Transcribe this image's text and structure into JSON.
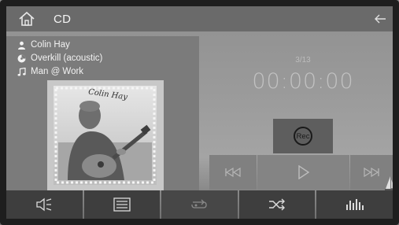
{
  "header": {
    "title": "CD"
  },
  "track": {
    "artist": "Colin Hay",
    "album": "Overkill (acoustic)",
    "title": "Man @ Work",
    "counter": "3/13",
    "elapsed": "00:00:00"
  },
  "controls": {
    "rec_label": "Rec"
  },
  "album_art": {
    "signature": "Colin Hay"
  },
  "icons": {
    "home": "home-icon",
    "back": "back-arrow-icon",
    "artist": "person-icon",
    "album": "disc-icon",
    "song": "music-note-icon",
    "prev": "skip-previous-icon",
    "play": "play-icon",
    "next": "skip-next-icon",
    "audio": "audio-settings-icon",
    "list": "list-icon",
    "repeat": "repeat-icon",
    "shuffle": "shuffle-icon",
    "equalizer": "equalizer-icon"
  },
  "colors": {
    "panel": "#7b7b7b",
    "topbar": "#6a6a6a",
    "bottombar": "#3e3e3e",
    "text_light": "#f2f2f2"
  }
}
